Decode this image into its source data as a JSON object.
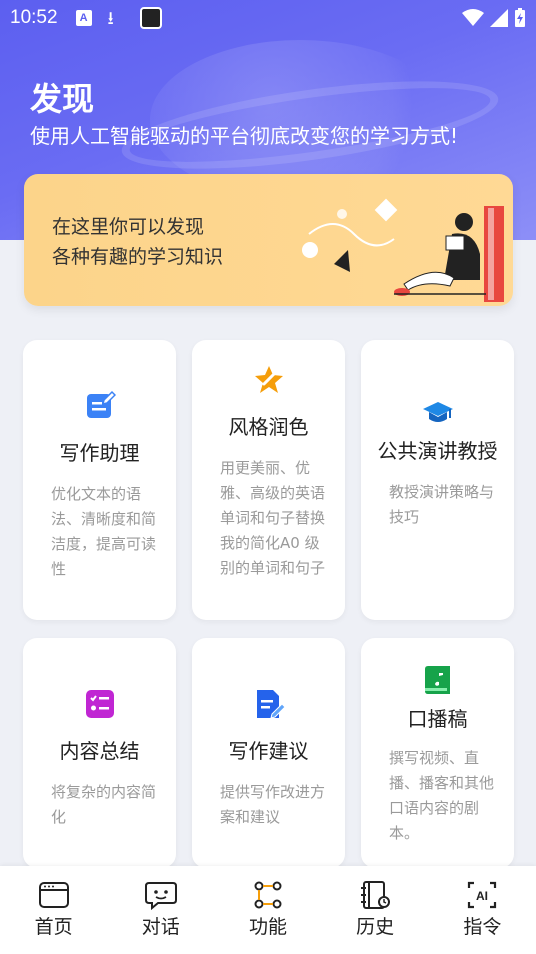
{
  "statusbar": {
    "time": "10:52"
  },
  "header": {
    "title": "发现",
    "subtitle": "使用人工智能驱动的平台彻底改变您的学习方式!"
  },
  "banner": {
    "text": "在这里你可以发现\n各种有趣的学习知识"
  },
  "cards": [
    {
      "title": "写作助理",
      "desc": "优化文本的语法、清晰度和简洁度，提高可读性",
      "icon": "edit-doc-icon",
      "color": "#3b82f6"
    },
    {
      "title": "风格润色",
      "desc": "用更美丽、优雅、高级的英语单词和句子替换我的简化A0 级别的单词和句子",
      "icon": "star-pen-icon",
      "color": "#f59e0b"
    },
    {
      "title": "公共演讲教授",
      "desc": "教授演讲策略与技巧",
      "icon": "graduation-cap-icon",
      "color": "#1e88e5"
    },
    {
      "title": "内容总结",
      "desc": "将复杂的内容简化",
      "icon": "checklist-icon",
      "color": "#c026d3"
    },
    {
      "title": "写作建议",
      "desc": "提供写作改进方案和建议",
      "icon": "doc-pen-icon",
      "color": "#2563eb"
    },
    {
      "title": "口播稿",
      "desc": "撰写视频、直播、播客和其他口语内容的剧本。",
      "icon": "green-book-icon",
      "color": "#16a34a"
    }
  ],
  "nav": [
    {
      "label": "首页",
      "icon": "home-window-icon"
    },
    {
      "label": "对话",
      "icon": "chat-bot-icon"
    },
    {
      "label": "功能",
      "icon": "function-nodes-icon"
    },
    {
      "label": "历史",
      "icon": "history-book-icon"
    },
    {
      "label": "指令",
      "icon": "ai-command-icon"
    }
  ]
}
